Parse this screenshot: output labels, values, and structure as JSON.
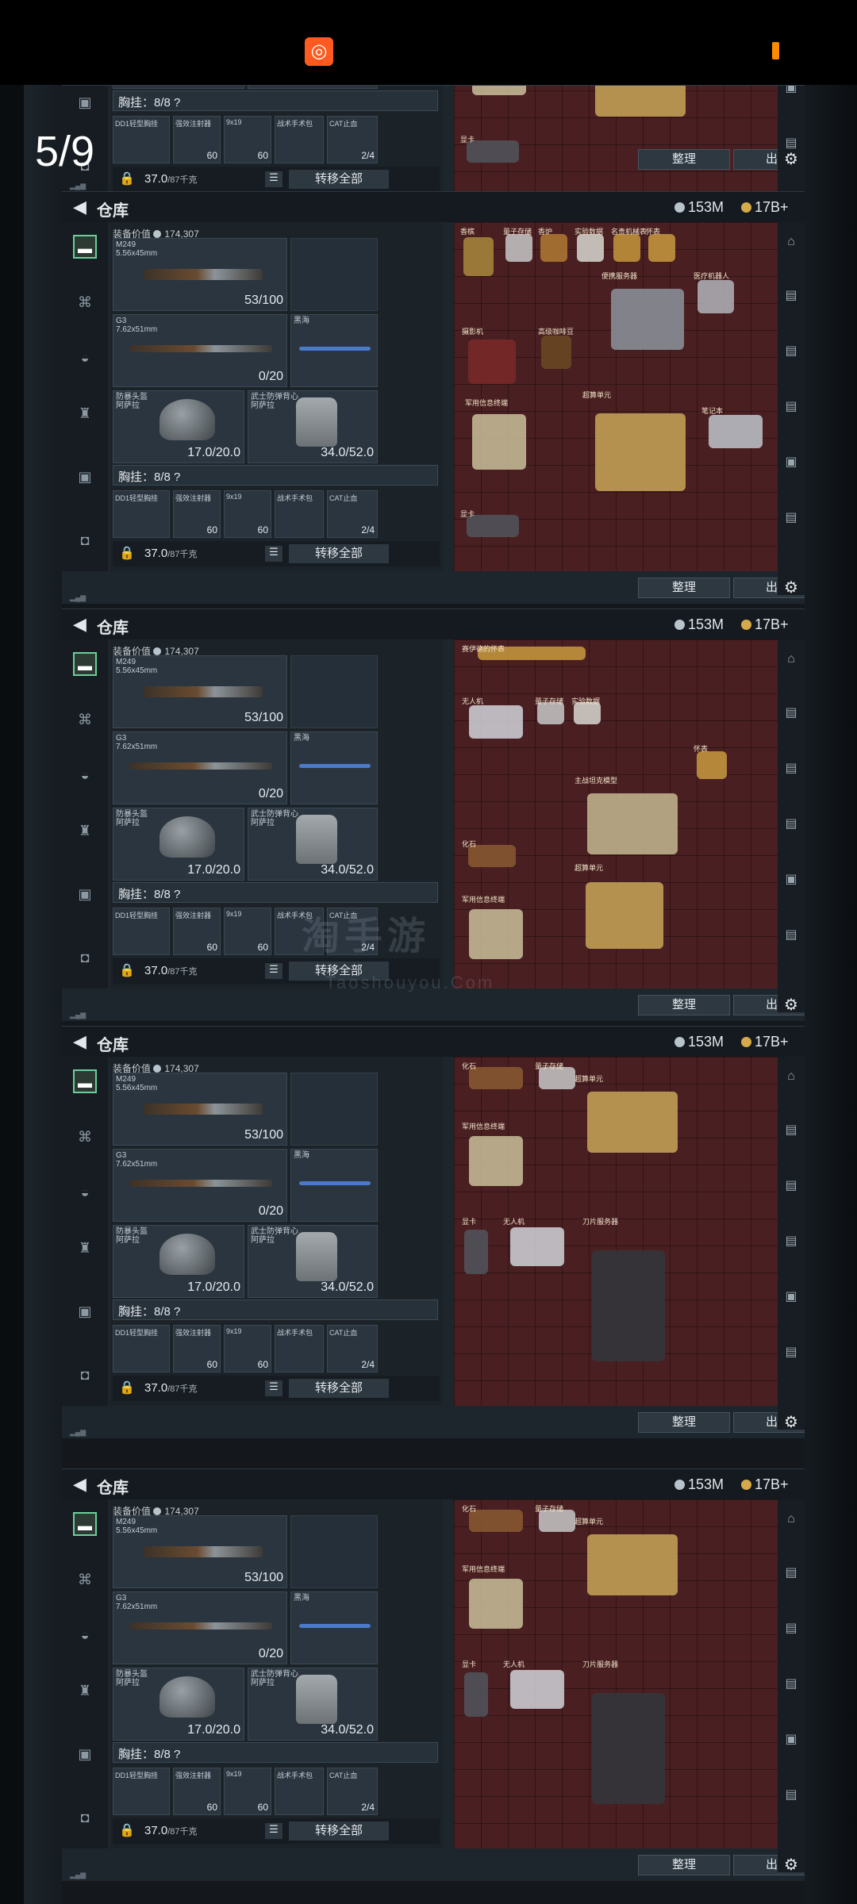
{
  "status_bar": {
    "app_icon": "kuaishou-logo",
    "battery_color": "#ff8a00"
  },
  "viewer": {
    "counter": "5/9"
  },
  "header": {
    "title": "仓库",
    "silver": "153M",
    "gold": "17B+"
  },
  "loadout": {
    "value_label": "装备价值",
    "value": "174,307",
    "primary": {
      "name": "M249",
      "caliber": "5.56x45mm",
      "ammo": "53/100"
    },
    "secondary": {
      "name": "G3",
      "caliber": "7.62x51mm",
      "ammo": "0/20"
    },
    "melee": {
      "name": "黑海"
    },
    "helmet": {
      "name": "防暴头盔",
      "sub": "阿萨拉",
      "durability": "17.0/20.0"
    },
    "armor": {
      "name": "武士防弹背心",
      "sub": "阿萨拉",
      "durability": "34.0/52.0"
    },
    "chest_rig": "胸挂：8/8 ?",
    "pouches": [
      {
        "name": "DD1轻型胸挂",
        "count": ""
      },
      {
        "name": "强效注射器",
        "count": "60"
      },
      {
        "name": "9x19",
        "count": "60"
      },
      {
        "name": "战术手术包",
        "count": ""
      },
      {
        "name": "CAT止血",
        "count": "2/4"
      }
    ],
    "weight": "37.0",
    "weight_cap": "/87千克",
    "transfer_all": "转移全部"
  },
  "stash": {
    "sort_label": "整理",
    "sell_label": "出售"
  },
  "panels": [
    {
      "items": [
        {
          "lb": "香槟",
          "c": "#a88a3c"
        },
        {
          "lb": "量子存储",
          "c": "#c8c8c8"
        },
        {
          "lb": "香炉",
          "c": "#b07a32"
        },
        {
          "lb": "实验数据",
          "c": "#d8d8d0"
        },
        {
          "lb": "名贵机械表",
          "c": "#c4963c"
        },
        {
          "lb": "怀表",
          "c": "#c89a40"
        },
        {
          "lb": "便携服务器",
          "c": "#8c949c"
        },
        {
          "lb": "医疗机器人",
          "c": "#b0b4b8"
        },
        {
          "lb": "摄影机",
          "c": "#7a2a28"
        },
        {
          "lb": "高级咖啡豆",
          "c": "#6a4a22"
        },
        {
          "lb": "军用信息终端",
          "c": "#c8c09a"
        },
        {
          "lb": "超算单元",
          "c": "#c8a658"
        },
        {
          "lb": "笔记本",
          "c": "#c0c6cc"
        },
        {
          "lb": "显卡",
          "c": "#50565c"
        }
      ]
    },
    {
      "items": [
        {
          "lb": "赛伊德的怀表",
          "c": "#c89a40"
        },
        {
          "lb": "无人机",
          "c": "#d0d4d8"
        },
        {
          "lb": "量子存储",
          "c": "#c8c8c8"
        },
        {
          "lb": "实验数据",
          "c": "#d8d8d0"
        },
        {
          "lb": "主战坦克模型",
          "c": "#c4b890"
        },
        {
          "lb": "怀表",
          "c": "#c89a40"
        },
        {
          "lb": "化石",
          "c": "#8a5a30"
        },
        {
          "lb": "超算单元",
          "c": "#c8a658"
        },
        {
          "lb": "军用信息终端",
          "c": "#c8c09a"
        }
      ]
    },
    {
      "items": [
        {
          "lb": "化石",
          "c": "#8a5a30"
        },
        {
          "lb": "量子存储",
          "c": "#c8c8c8"
        },
        {
          "lb": "超算单元",
          "c": "#c8a658"
        },
        {
          "lb": "军用信息终端",
          "c": "#c8c09a"
        },
        {
          "lb": "显卡",
          "c": "#50565c"
        },
        {
          "lb": "无人机",
          "c": "#d0d4d8"
        },
        {
          "lb": "刀片服务器",
          "c": "#33373c"
        }
      ]
    },
    {
      "items": [
        {
          "lb": "化石",
          "c": "#8a5a30"
        },
        {
          "lb": "量子存储",
          "c": "#c8c8c8"
        },
        {
          "lb": "超算单元",
          "c": "#c8a658"
        },
        {
          "lb": "军用信息终端",
          "c": "#c8c09a"
        },
        {
          "lb": "显卡",
          "c": "#50565c"
        },
        {
          "lb": "无人机",
          "c": "#d0d4d8"
        },
        {
          "lb": "刀片服务器",
          "c": "#33373c"
        }
      ]
    }
  ],
  "watermark": {
    "cn": "淘手游",
    "en": "Taoshouyou.Com"
  },
  "icons": {
    "back": "chevron-left-icon",
    "lock": "lock-icon",
    "list": "list-icon",
    "settings": "gear-icon"
  }
}
